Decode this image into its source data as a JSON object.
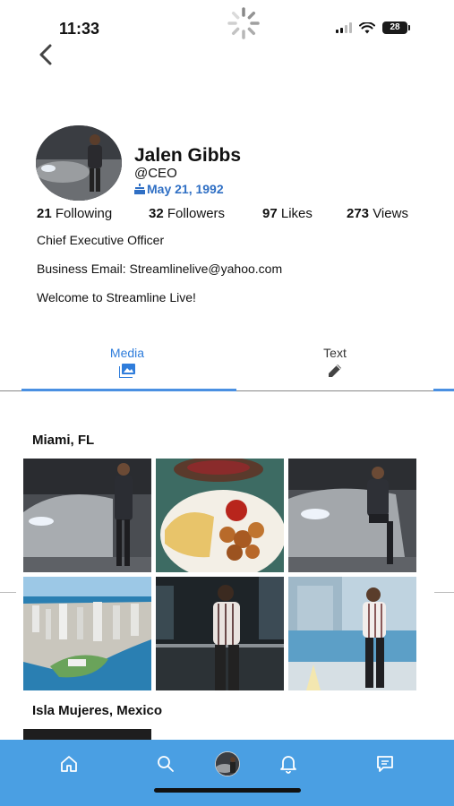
{
  "status_bar": {
    "time": "11:33",
    "battery": "28"
  },
  "profile": {
    "name": "Jalen Gibbs",
    "handle": "@CEO",
    "birthday": "May 21, 1992",
    "stats": [
      {
        "count": "21",
        "label": "Following"
      },
      {
        "count": "32",
        "label": "Followers"
      },
      {
        "count": "97",
        "label": "Likes"
      },
      {
        "count": "273",
        "label": "Views"
      }
    ],
    "bio": [
      "Chief Executive Officer",
      "Business Email: Streamlinelive@yahoo.com",
      "Welcome to Streamline Live!"
    ]
  },
  "tabs": [
    {
      "label": "Media",
      "icon": "image-icon",
      "active": true
    },
    {
      "label": "Text",
      "icon": "pencil-icon",
      "active": false
    }
  ],
  "sections": [
    {
      "title": "Miami, FL"
    },
    {
      "title": "Isla Mujeres, Mexico"
    }
  ],
  "bottom_nav": [
    "home-icon",
    "search-icon",
    "profile-avatar",
    "bell-icon",
    "message-icon"
  ],
  "colors": {
    "accent": "#2f7ddb",
    "nav_bg": "#4a9fe3",
    "birthday": "#2f6fc4"
  }
}
